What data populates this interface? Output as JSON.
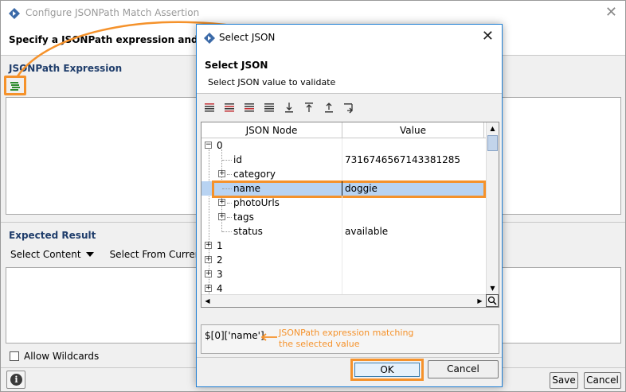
{
  "background_dialog": {
    "title": "Configure JSONPath Match Assertion",
    "header_text": "Specify a JSONPath expression and the ex",
    "jsonpath_section_title": "JSONPath Expression",
    "expected_section_title": "Expected Result",
    "select_content_label": "Select Content",
    "select_from_current_label": "Select From Current",
    "allow_wildcards_label": "Allow Wildcards",
    "info_icon": "info-icon",
    "save_label": "Save",
    "cancel_label": "Cancel"
  },
  "select_json_dialog": {
    "title": "Select JSON",
    "heading": "Select JSON",
    "subheading": "Select JSON value to validate",
    "columns": [
      "JSON Node",
      "Value"
    ],
    "rows": [
      {
        "node": "0",
        "value": ""
      },
      {
        "node": "id",
        "value": "7316746567143381285"
      },
      {
        "node": "category",
        "value": ""
      },
      {
        "node": "name",
        "value": "doggie"
      },
      {
        "node": "photoUrls",
        "value": ""
      },
      {
        "node": "tags",
        "value": ""
      },
      {
        "node": "status",
        "value": "available"
      },
      {
        "node": "1",
        "value": ""
      },
      {
        "node": "2",
        "value": ""
      },
      {
        "node": "3",
        "value": ""
      },
      {
        "node": "4",
        "value": ""
      }
    ],
    "expression": "$[0]['name']",
    "annotation_line1": "JSONPath expression matching",
    "annotation_line2": "the selected value",
    "ok_label": "OK",
    "cancel_label": "Cancel"
  },
  "accent_color": "#f5922b",
  "selection_color": "#b8d3f2"
}
